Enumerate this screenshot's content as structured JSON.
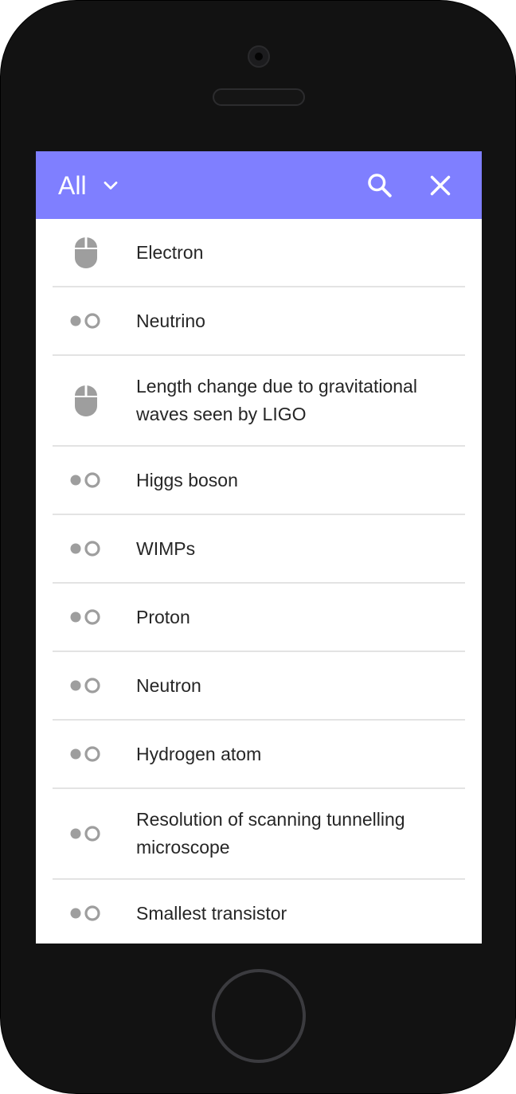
{
  "app_bar": {
    "filter_label": "All",
    "filter_icon": "chevron-down-icon",
    "search_icon": "search-icon",
    "close_icon": "close-icon",
    "background_color": "#7f7fff"
  },
  "items": [
    {
      "label": "Electron",
      "icon": "mouse-icon"
    },
    {
      "label": "Neutrino",
      "icon": "toggle-icon"
    },
    {
      "label": "Length change due to gravitational waves seen by LIGO",
      "icon": "mouse-icon"
    },
    {
      "label": "Higgs boson",
      "icon": "toggle-icon"
    },
    {
      "label": "WIMPs",
      "icon": "toggle-icon"
    },
    {
      "label": "Proton",
      "icon": "toggle-icon"
    },
    {
      "label": "Neutron",
      "icon": "toggle-icon"
    },
    {
      "label": "Hydrogen atom",
      "icon": "toggle-icon"
    },
    {
      "label": "Resolution of scanning tunnelling microscope",
      "icon": "toggle-icon"
    },
    {
      "label": "Smallest transistor",
      "icon": "toggle-icon"
    }
  ]
}
